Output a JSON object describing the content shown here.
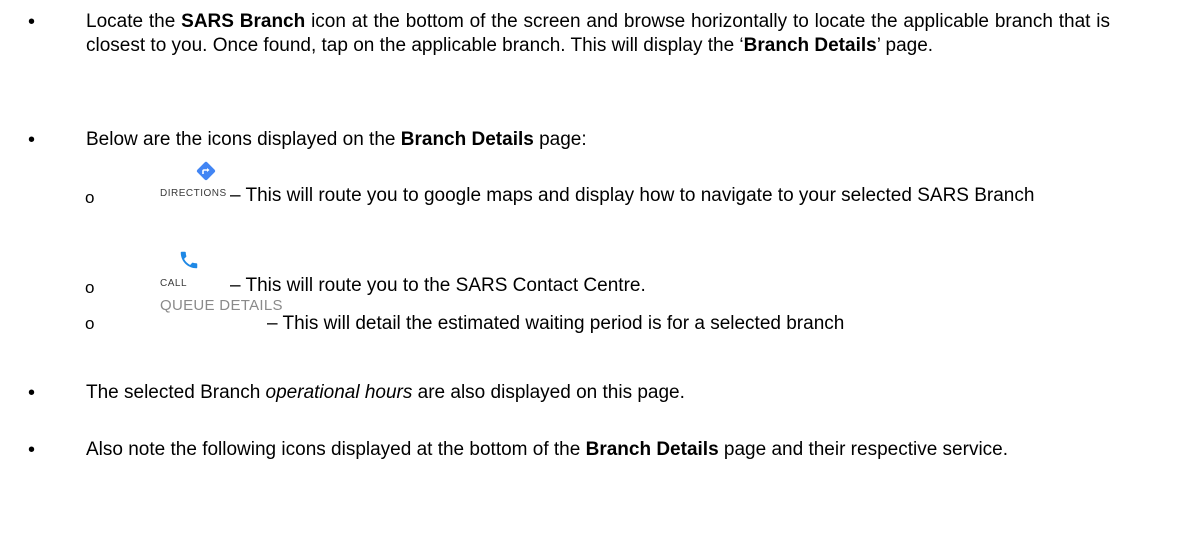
{
  "bullet_glyph": "•",
  "sub_glyph": "o",
  "p1": {
    "a": "Locate the ",
    "b": "SARS Branch",
    "c": " icon at the bottom of the screen and browse horizontally to locate the applicable branch that is closest to you. Once found, tap on the applicable branch. This will display the ‘",
    "d": "Branch Details",
    "e": "’ page."
  },
  "p2": {
    "a": "Below are the icons displayed on the ",
    "b": "Branch Details",
    "c": " page:"
  },
  "items": {
    "directions": {
      "icon": "directions-icon",
      "icon_color": "#4285F4",
      "label": "DIRECTIONS",
      "text": " – This will route you to google maps and display how to navigate to your selected SARS Branch"
    },
    "call": {
      "icon": "phone-icon",
      "icon_color": "#1E88E5",
      "label": "CALL",
      "text": " – This will route you to the SARS Contact Centre."
    },
    "queue": {
      "label": "QUEUE DETAILS",
      "text": "– This will detail the estimated waiting period is for a selected branch"
    }
  },
  "p3": {
    "a": "The selected Branch ",
    "b": "operational hours",
    "c": " are also displayed on this page."
  },
  "p4": {
    "a": "Also note the following icons displayed at the bottom of the ",
    "b": "Branch Details",
    "c": " page and their respective service."
  }
}
